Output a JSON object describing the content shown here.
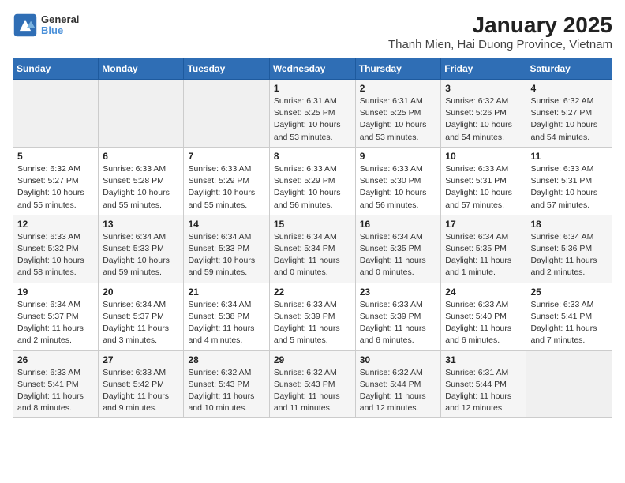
{
  "logo": {
    "line1": "General",
    "line2": "Blue"
  },
  "title": "January 2025",
  "subtitle": "Thanh Mien, Hai Duong Province, Vietnam",
  "days_of_week": [
    "Sunday",
    "Monday",
    "Tuesday",
    "Wednesday",
    "Thursday",
    "Friday",
    "Saturday"
  ],
  "weeks": [
    [
      {
        "day": "",
        "detail": ""
      },
      {
        "day": "",
        "detail": ""
      },
      {
        "day": "",
        "detail": ""
      },
      {
        "day": "1",
        "detail": "Sunrise: 6:31 AM\nSunset: 5:25 PM\nDaylight: 10 hours\nand 53 minutes."
      },
      {
        "day": "2",
        "detail": "Sunrise: 6:31 AM\nSunset: 5:25 PM\nDaylight: 10 hours\nand 53 minutes."
      },
      {
        "day": "3",
        "detail": "Sunrise: 6:32 AM\nSunset: 5:26 PM\nDaylight: 10 hours\nand 54 minutes."
      },
      {
        "day": "4",
        "detail": "Sunrise: 6:32 AM\nSunset: 5:27 PM\nDaylight: 10 hours\nand 54 minutes."
      }
    ],
    [
      {
        "day": "5",
        "detail": "Sunrise: 6:32 AM\nSunset: 5:27 PM\nDaylight: 10 hours\nand 55 minutes."
      },
      {
        "day": "6",
        "detail": "Sunrise: 6:33 AM\nSunset: 5:28 PM\nDaylight: 10 hours\nand 55 minutes."
      },
      {
        "day": "7",
        "detail": "Sunrise: 6:33 AM\nSunset: 5:29 PM\nDaylight: 10 hours\nand 55 minutes."
      },
      {
        "day": "8",
        "detail": "Sunrise: 6:33 AM\nSunset: 5:29 PM\nDaylight: 10 hours\nand 56 minutes."
      },
      {
        "day": "9",
        "detail": "Sunrise: 6:33 AM\nSunset: 5:30 PM\nDaylight: 10 hours\nand 56 minutes."
      },
      {
        "day": "10",
        "detail": "Sunrise: 6:33 AM\nSunset: 5:31 PM\nDaylight: 10 hours\nand 57 minutes."
      },
      {
        "day": "11",
        "detail": "Sunrise: 6:33 AM\nSunset: 5:31 PM\nDaylight: 10 hours\nand 57 minutes."
      }
    ],
    [
      {
        "day": "12",
        "detail": "Sunrise: 6:33 AM\nSunset: 5:32 PM\nDaylight: 10 hours\nand 58 minutes."
      },
      {
        "day": "13",
        "detail": "Sunrise: 6:34 AM\nSunset: 5:33 PM\nDaylight: 10 hours\nand 59 minutes."
      },
      {
        "day": "14",
        "detail": "Sunrise: 6:34 AM\nSunset: 5:33 PM\nDaylight: 10 hours\nand 59 minutes."
      },
      {
        "day": "15",
        "detail": "Sunrise: 6:34 AM\nSunset: 5:34 PM\nDaylight: 11 hours\nand 0 minutes."
      },
      {
        "day": "16",
        "detail": "Sunrise: 6:34 AM\nSunset: 5:35 PM\nDaylight: 11 hours\nand 0 minutes."
      },
      {
        "day": "17",
        "detail": "Sunrise: 6:34 AM\nSunset: 5:35 PM\nDaylight: 11 hours\nand 1 minute."
      },
      {
        "day": "18",
        "detail": "Sunrise: 6:34 AM\nSunset: 5:36 PM\nDaylight: 11 hours\nand 2 minutes."
      }
    ],
    [
      {
        "day": "19",
        "detail": "Sunrise: 6:34 AM\nSunset: 5:37 PM\nDaylight: 11 hours\nand 2 minutes."
      },
      {
        "day": "20",
        "detail": "Sunrise: 6:34 AM\nSunset: 5:37 PM\nDaylight: 11 hours\nand 3 minutes."
      },
      {
        "day": "21",
        "detail": "Sunrise: 6:34 AM\nSunset: 5:38 PM\nDaylight: 11 hours\nand 4 minutes."
      },
      {
        "day": "22",
        "detail": "Sunrise: 6:33 AM\nSunset: 5:39 PM\nDaylight: 11 hours\nand 5 minutes."
      },
      {
        "day": "23",
        "detail": "Sunrise: 6:33 AM\nSunset: 5:39 PM\nDaylight: 11 hours\nand 6 minutes."
      },
      {
        "day": "24",
        "detail": "Sunrise: 6:33 AM\nSunset: 5:40 PM\nDaylight: 11 hours\nand 6 minutes."
      },
      {
        "day": "25",
        "detail": "Sunrise: 6:33 AM\nSunset: 5:41 PM\nDaylight: 11 hours\nand 7 minutes."
      }
    ],
    [
      {
        "day": "26",
        "detail": "Sunrise: 6:33 AM\nSunset: 5:41 PM\nDaylight: 11 hours\nand 8 minutes."
      },
      {
        "day": "27",
        "detail": "Sunrise: 6:33 AM\nSunset: 5:42 PM\nDaylight: 11 hours\nand 9 minutes."
      },
      {
        "day": "28",
        "detail": "Sunrise: 6:32 AM\nSunset: 5:43 PM\nDaylight: 11 hours\nand 10 minutes."
      },
      {
        "day": "29",
        "detail": "Sunrise: 6:32 AM\nSunset: 5:43 PM\nDaylight: 11 hours\nand 11 minutes."
      },
      {
        "day": "30",
        "detail": "Sunrise: 6:32 AM\nSunset: 5:44 PM\nDaylight: 11 hours\nand 12 minutes."
      },
      {
        "day": "31",
        "detail": "Sunrise: 6:31 AM\nSunset: 5:44 PM\nDaylight: 11 hours\nand 12 minutes."
      },
      {
        "day": "",
        "detail": ""
      }
    ]
  ]
}
